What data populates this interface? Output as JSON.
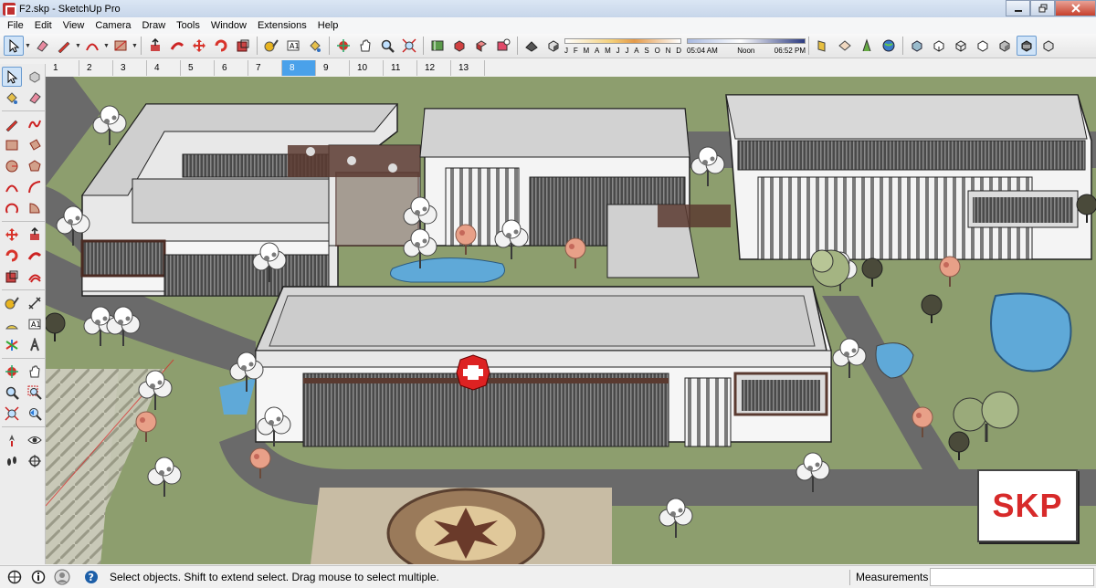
{
  "window": {
    "title": "F2.skp - SketchUp Pro"
  },
  "menu": [
    "File",
    "Edit",
    "View",
    "Camera",
    "Draw",
    "Tools",
    "Window",
    "Extensions",
    "Help"
  ],
  "shadows": {
    "months": [
      "J",
      "F",
      "M",
      "A",
      "M",
      "J",
      "J",
      "A",
      "S",
      "O",
      "N",
      "D"
    ],
    "time_start": "05:04 AM",
    "time_mid": "Noon",
    "time_end": "06:52 PM"
  },
  "scenes": {
    "tabs": [
      "1",
      "2",
      "3",
      "4",
      "5",
      "6",
      "7",
      "8",
      "9",
      "10",
      "11",
      "12",
      "13"
    ],
    "active": "8"
  },
  "logo": {
    "text": "SKP",
    "color": "#d72a2a"
  },
  "status": {
    "hint": "Select objects. Shift to extend select. Drag mouse to select multiple.",
    "measurements_label": "Measurements",
    "measurements_value": ""
  },
  "colors": {
    "accent": "#4aa1ea",
    "grass": "#8d9e6e",
    "road": "#6a6a6a",
    "water": "#5fa9d8"
  }
}
